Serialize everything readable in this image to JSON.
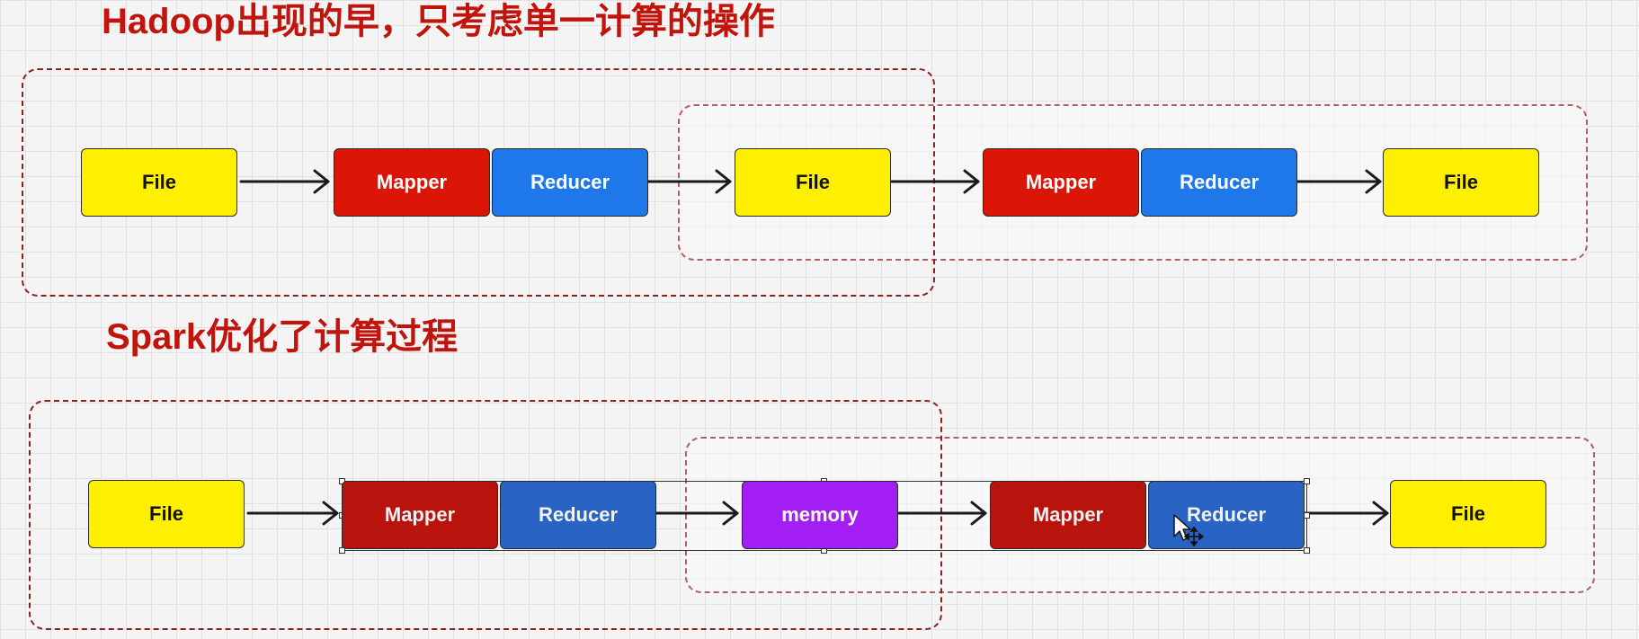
{
  "titles": {
    "hadoop": "Hadoop出现的早，只考虑单一计算的操作",
    "spark": "Spark优化了计算过程"
  },
  "hadoop_flow": {
    "file_1": "File",
    "mapper_1": "Mapper",
    "reducer_1": "Reducer",
    "file_2": "File",
    "mapper_2": "Mapper",
    "reducer_2": "Reducer",
    "file_3": "File"
  },
  "spark_flow": {
    "file_1": "File",
    "mapper_1": "Mapper",
    "reducer_1": "Reducer",
    "memory": "memory",
    "mapper_2": "Mapper",
    "reducer_2": "Reducer",
    "file_2": "File"
  },
  "colors": {
    "title": "#c0140c",
    "file": "#ffef00",
    "mapper": "#db1606",
    "reducer": "#1f78ea",
    "memory": "#a21ef3",
    "dashed_border": "#8c2020"
  }
}
